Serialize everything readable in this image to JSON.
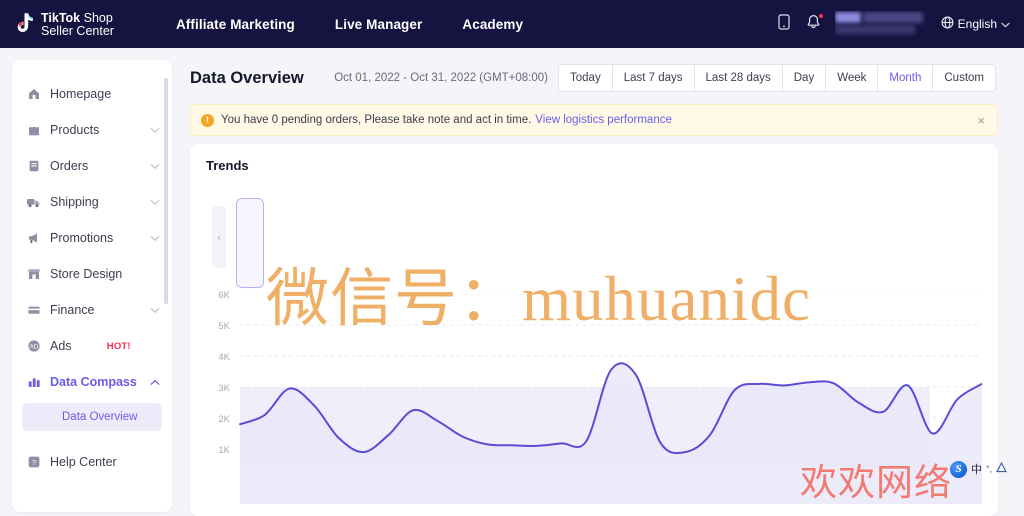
{
  "topnav": {
    "logo": {
      "brand": "TikTok",
      "shop": " Shop",
      "line2": "Seller Center",
      "icon": "tiktok-note-icon"
    },
    "links": [
      {
        "label": "Affiliate Marketing"
      },
      {
        "label": "Live Manager"
      },
      {
        "label": "Academy"
      }
    ],
    "icons": {
      "mobile": "mobile-phone-icon",
      "bell": "notification-bell-icon",
      "globe": "globe-icon",
      "chevron": "chevron-down-icon"
    },
    "language": "English",
    "account_label": ""
  },
  "sidebar": {
    "items": [
      {
        "label": "Homepage",
        "icon": "home-icon",
        "expandable": false,
        "active": false
      },
      {
        "label": "Products",
        "icon": "bag-icon",
        "expandable": true,
        "active": false
      },
      {
        "label": "Orders",
        "icon": "receipt-icon",
        "expandable": true,
        "active": false
      },
      {
        "label": "Shipping",
        "icon": "truck-icon",
        "expandable": true,
        "active": false
      },
      {
        "label": "Promotions",
        "icon": "megaphone-icon",
        "expandable": true,
        "active": false
      },
      {
        "label": "Store Design",
        "icon": "storefront-icon",
        "expandable": false,
        "active": false
      },
      {
        "label": "Finance",
        "icon": "card-icon",
        "expandable": true,
        "active": false
      },
      {
        "label": "Ads",
        "icon": "ads-icon",
        "expandable": false,
        "active": false,
        "tag": "HOT!"
      },
      {
        "label": "Data Compass",
        "icon": "bar-chart-icon",
        "expandable": true,
        "active": true,
        "expanded": true
      },
      {
        "label": "Help Center",
        "icon": "help-icon",
        "expandable": false,
        "active": false
      }
    ],
    "subitem": {
      "label": "Data Overview",
      "selected": true
    }
  },
  "page": {
    "title": "Data Overview",
    "date_range": "Oct 01, 2022 - Oct 31, 2022 (GMT+08:00)",
    "range_buttons": [
      {
        "label": "Today",
        "active": false
      },
      {
        "label": "Last 7 days",
        "active": false
      },
      {
        "label": "Last 28 days",
        "active": false
      },
      {
        "label": "Day",
        "active": false
      },
      {
        "label": "Week",
        "active": false
      },
      {
        "label": "Month",
        "active": true
      },
      {
        "label": "Custom",
        "active": false
      }
    ]
  },
  "banner": {
    "icon": "warning-circle-icon",
    "text": "You have 0 pending orders, Please take note and act in time.",
    "link": "View logistics performance",
    "close": "×"
  },
  "card": {
    "title": "Trends",
    "carousel_prev": "‹"
  },
  "chart_data": {
    "type": "line",
    "title": "Trends",
    "xlabel": "",
    "ylabel": "",
    "grid": true,
    "legend_position": "none",
    "line_color": "#5b4bd6",
    "area_fill": "#e9e8f8",
    "ylim": [
      0,
      6500
    ],
    "yticks": [
      "1K",
      "2K",
      "3K",
      "4K",
      "5K",
      "6K"
    ],
    "ytick_values": [
      1000,
      2000,
      3000,
      4000,
      5000,
      6000
    ],
    "x": [
      1,
      2,
      3,
      4,
      5,
      6,
      7,
      8,
      9,
      10,
      11,
      12,
      13,
      14,
      15,
      16,
      17,
      18,
      19,
      20,
      21,
      22,
      23,
      24,
      25,
      26,
      27,
      28,
      29,
      30,
      31
    ],
    "series": [
      {
        "name": "Trend",
        "values": [
          1800,
          2100,
          2950,
          2400,
          1350,
          900,
          1450,
          2250,
          1900,
          1400,
          1150,
          1120,
          1100,
          1180,
          1250,
          3550,
          3400,
          1200,
          900,
          1450,
          2900,
          3100,
          3050,
          3150,
          3120,
          2500,
          2200,
          3050,
          1500,
          2600,
          3100
        ]
      }
    ]
  },
  "watermarks": {
    "orange": "微信号：muhuanidc",
    "red": "欢欢网络"
  },
  "ime": {
    "logo": "S",
    "mode": "中",
    "misc": "°,"
  }
}
